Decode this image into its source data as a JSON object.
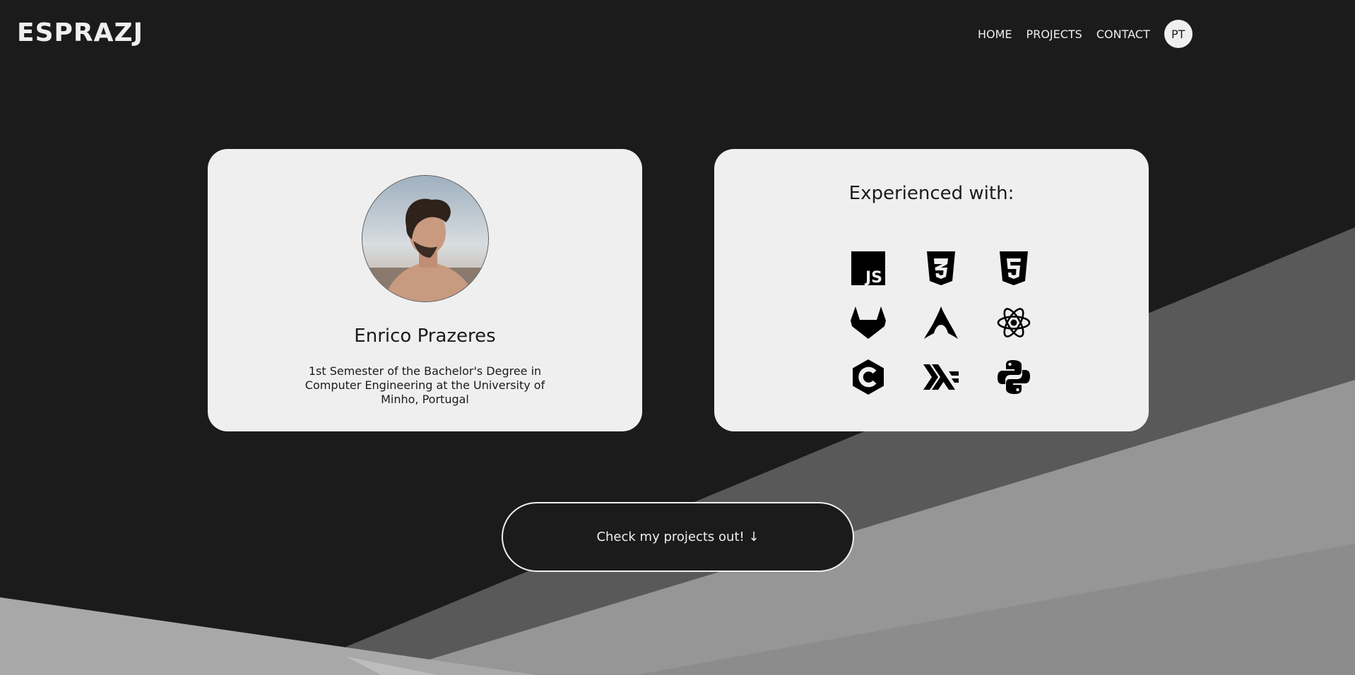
{
  "header": {
    "logo": "ESPRAZJ",
    "nav": [
      {
        "label": "HOME"
      },
      {
        "label": "PROJECTS"
      },
      {
        "label": "CONTACT"
      }
    ],
    "language_button": "PT"
  },
  "profile": {
    "name": "Enrico Prazeres",
    "description": "1st Semester of the Bachelor's Degree in Computer Engineering at the University of Minho, Portugal"
  },
  "skills": {
    "title": "Experienced with:",
    "icons": [
      "javascript-icon",
      "css3-icon",
      "html5-icon",
      "gitlab-icon",
      "arch-linux-icon",
      "react-icon",
      "c-language-icon",
      "haskell-icon",
      "python-icon"
    ]
  },
  "cta": {
    "label": "Check my projects out! ↓"
  },
  "colors": {
    "background": "#1b1b1b",
    "card": "#efefef",
    "text_light": "#efefef",
    "shape_dark_gray": "#595959",
    "shape_mid_gray": "#939393",
    "shape_light_gray": "#b5b5b5"
  }
}
